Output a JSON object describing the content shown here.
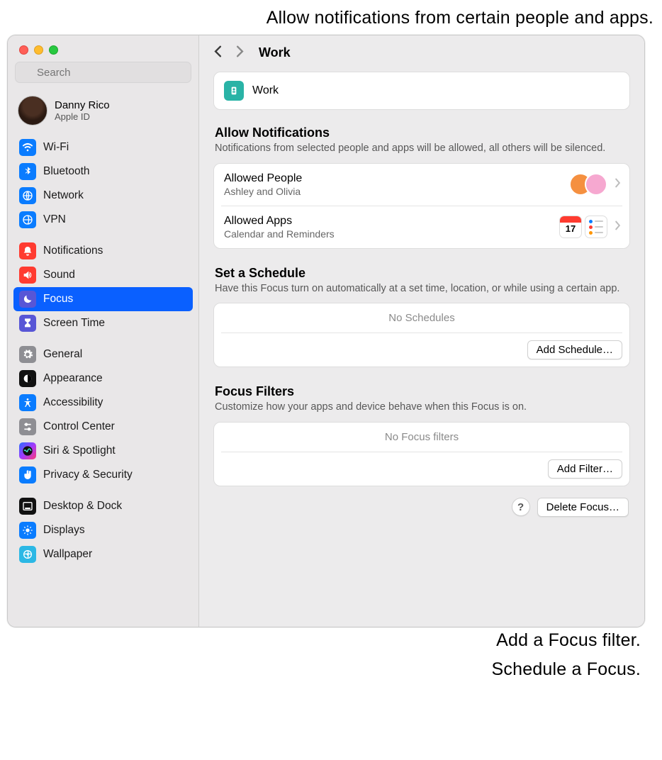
{
  "annotations": {
    "top": "Allow notifications from certain people and apps.",
    "bottom1": "Add a Focus filter.",
    "bottom2": "Schedule a Focus."
  },
  "search": {
    "placeholder": "Search"
  },
  "profile": {
    "name": "Danny Rico",
    "sub": "Apple ID"
  },
  "sidebar": {
    "g1": [
      {
        "label": "Wi-Fi",
        "color": "#0a7cff",
        "icon": "wifi"
      },
      {
        "label": "Bluetooth",
        "color": "#0a7cff",
        "icon": "bluetooth"
      },
      {
        "label": "Network",
        "color": "#0a7cff",
        "icon": "network"
      },
      {
        "label": "VPN",
        "color": "#0a7cff",
        "icon": "vpn"
      }
    ],
    "g2": [
      {
        "label": "Notifications",
        "color": "#ff3b30",
        "icon": "bell"
      },
      {
        "label": "Sound",
        "color": "#ff3b30",
        "icon": "sound"
      },
      {
        "label": "Focus",
        "color": "#5856d6",
        "icon": "moon",
        "selected": true
      },
      {
        "label": "Screen Time",
        "color": "#5856d6",
        "icon": "hourglass"
      }
    ],
    "g3": [
      {
        "label": "General",
        "color": "#8e8e93",
        "icon": "gear"
      },
      {
        "label": "Appearance",
        "color": "#111",
        "icon": "appearance"
      },
      {
        "label": "Accessibility",
        "color": "#0a7cff",
        "icon": "accessibility"
      },
      {
        "label": "Control Center",
        "color": "#8e8e93",
        "icon": "control"
      },
      {
        "label": "Siri & Spotlight",
        "color": "grad",
        "icon": "siri"
      },
      {
        "label": "Privacy & Security",
        "color": "#0a7cff",
        "icon": "hand"
      }
    ],
    "g4": [
      {
        "label": "Desktop & Dock",
        "color": "#111",
        "icon": "dock"
      },
      {
        "label": "Displays",
        "color": "#0a7cff",
        "icon": "display"
      },
      {
        "label": "Wallpaper",
        "color": "#2cb8e5",
        "icon": "wallpaper"
      }
    ]
  },
  "toolbar": {
    "title": "Work"
  },
  "header": {
    "label": "Work"
  },
  "allow": {
    "title": "Allow Notifications",
    "sub": "Notifications from selected people and apps will be allowed, all others will be silenced.",
    "people_t": "Allowed People",
    "people_s": "Ashley and Olivia",
    "apps_t": "Allowed Apps",
    "apps_s": "Calendar and Reminders"
  },
  "schedule": {
    "title": "Set a Schedule",
    "sub": "Have this Focus turn on automatically at a set time, location, or while using a certain app.",
    "empty": "No Schedules",
    "button": "Add Schedule…"
  },
  "filters": {
    "title": "Focus Filters",
    "sub": "Customize how your apps and device behave when this Focus is on.",
    "empty": "No Focus filters",
    "button": "Add Filter…"
  },
  "footer": {
    "help": "?",
    "delete": "Delete Focus…"
  }
}
